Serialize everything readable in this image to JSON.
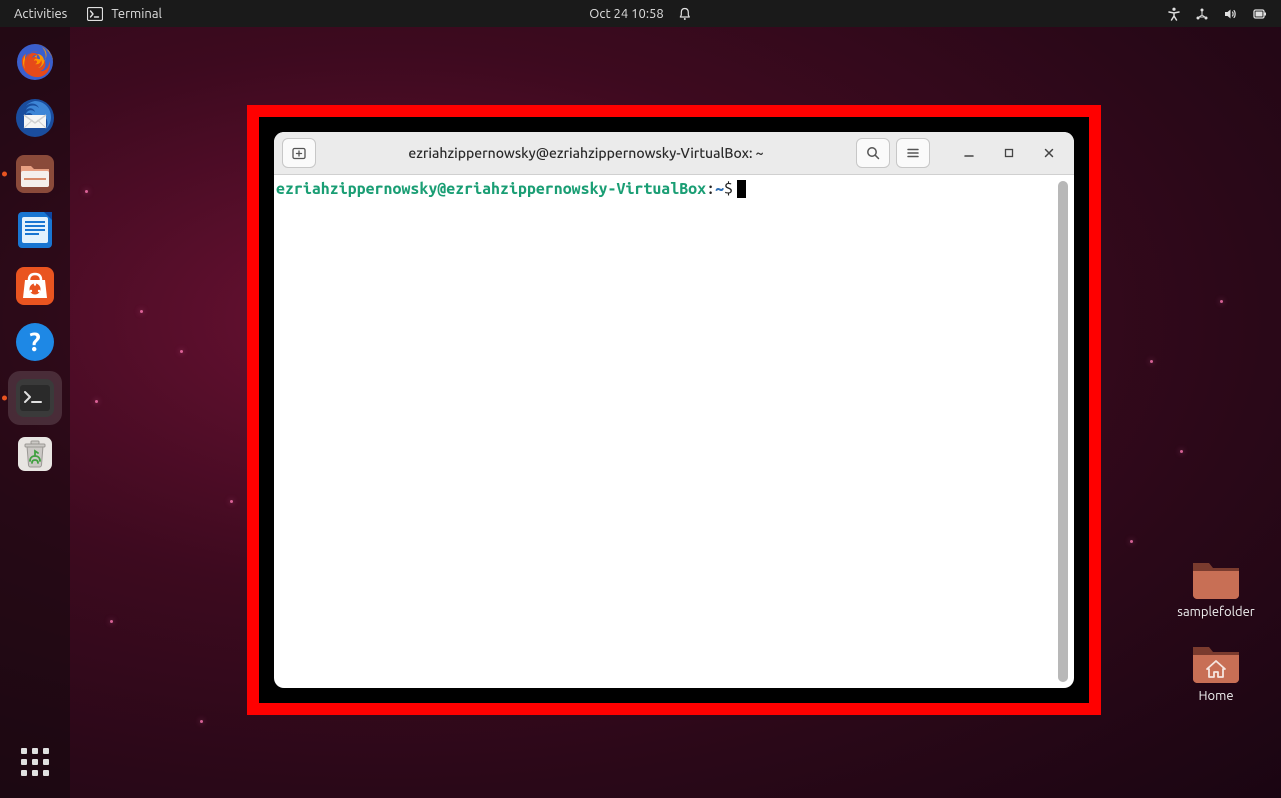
{
  "topbar": {
    "activities_label": "Activities",
    "app_label": "Terminal",
    "datetime": "Oct 24  10:58"
  },
  "dock": {
    "items": [
      {
        "name": "firefox"
      },
      {
        "name": "thunderbird"
      },
      {
        "name": "files"
      },
      {
        "name": "libreoffice-writer"
      },
      {
        "name": "ubuntu-software"
      },
      {
        "name": "help"
      },
      {
        "name": "terminal",
        "active": true
      },
      {
        "name": "trash"
      }
    ]
  },
  "desktop": {
    "folder1_label": "samplefolder",
    "home_label": "Home"
  },
  "terminal": {
    "title": "ezriahzippernowsky@ezriahzippernowsky-VirtualBox: ~",
    "prompt_userhost": "ezriahzippernowsky@ezriahzippernowsky-VirtualBox",
    "prompt_sep1": ":",
    "prompt_path": "~",
    "prompt_sep2": "$"
  }
}
